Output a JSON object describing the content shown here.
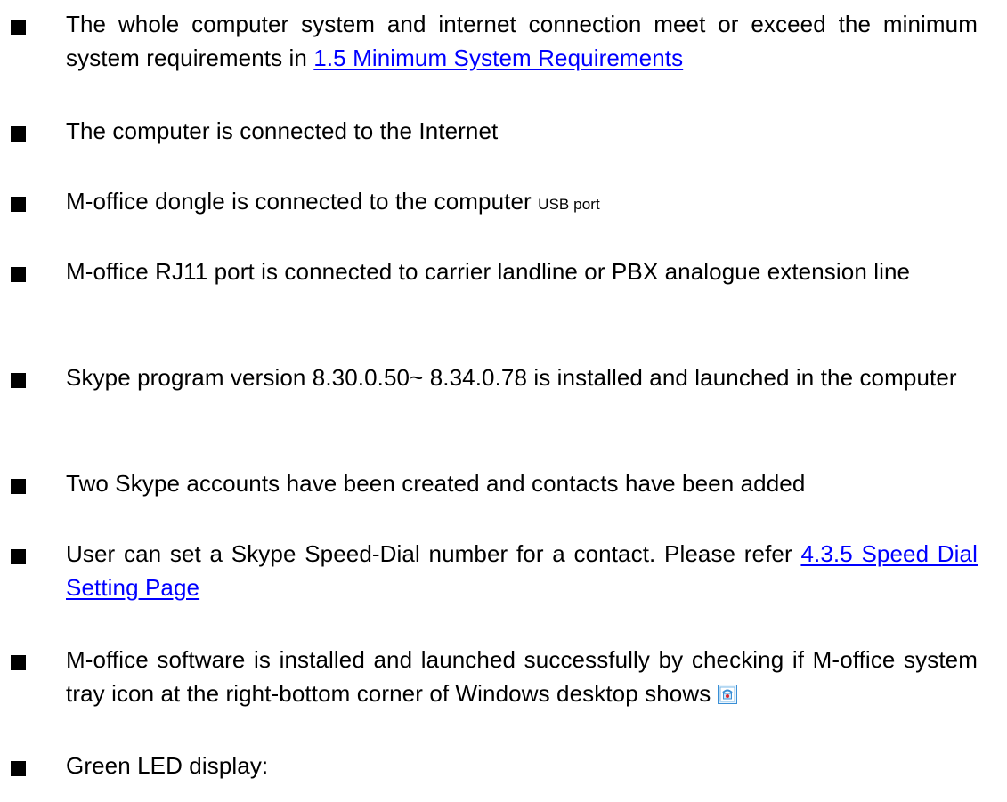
{
  "items": [
    {
      "text_before": "The whole computer system and internet connection meet or exceed the minimum system requirements in ",
      "link": "1.5 Minimum System Requirements"
    },
    {
      "text": "The computer is connected to the Internet"
    },
    {
      "text": "M-office dongle is connected to the computer ",
      "small": "USB port"
    },
    {
      "text": "M-office RJ11 port is connected to carrier landline or PBX analogue extension line"
    },
    {
      "text": "Skype program version 8.30.0.50~ 8.34.0.78 is installed and launched in the computer"
    },
    {
      "text": "Two Skype accounts have been created and contacts have been added"
    },
    {
      "text_before": "User can set a Skype Speed-Dial number for a contact. Please refer ",
      "link": "4.3.5 Speed Dial Setting Page"
    },
    {
      "text_before": "M-office software is installed and launched successfully by checking if M-office system tray icon at the right-bottom corner of Windows desktop shows",
      "icon": "m-office-tray-icon"
    },
    {
      "text": "Green LED display:"
    }
  ],
  "colors": {
    "link": "#0000ff",
    "bullet": "#000000",
    "text": "#000000",
    "tray_icon_frame": "#3a8fd6",
    "tray_icon_accent": "#d8262e"
  }
}
